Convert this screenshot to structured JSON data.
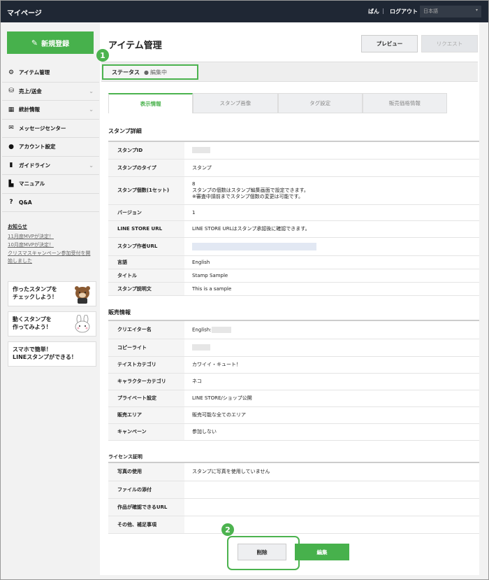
{
  "header": {
    "title": "マイページ",
    "user": "ぱん",
    "separator": "|",
    "logout": "ログアウト",
    "language": "日本語",
    "language_caret": "▾"
  },
  "sidebar": {
    "new_button": "新規登録",
    "items": [
      {
        "label": "アイテム管理",
        "icon": "gear-icon",
        "glyph": "⚙",
        "chev": ""
      },
      {
        "label": "売上/送金",
        "icon": "coins-icon",
        "glyph": "⛁",
        "chev": "⌄"
      },
      {
        "label": "統計情報",
        "icon": "chart-icon",
        "glyph": "▦",
        "chev": "⌄"
      },
      {
        "label": "メッセージセンター",
        "icon": "mail-icon",
        "glyph": "✉",
        "chev": ""
      },
      {
        "label": "アカウント設定",
        "icon": "person-icon",
        "glyph": "●",
        "chev": ""
      },
      {
        "label": "ガイドライン",
        "icon": "book-icon",
        "glyph": "▮",
        "chev": "⌄"
      },
      {
        "label": "マニュアル",
        "icon": "document-icon",
        "glyph": "▙",
        "chev": ""
      },
      {
        "label": "Q&A",
        "icon": "help-icon",
        "glyph": "?",
        "chev": ""
      }
    ],
    "news": {
      "heading": "お知らせ",
      "links": [
        "11月度MVPが決定！",
        "10月度MVPが決定！",
        "クリスマスキャンペーン参加受付を開始しました"
      ]
    },
    "cards": [
      {
        "line1": "作ったスタンプを",
        "line2": "チェックしよう！"
      },
      {
        "line1": "動くスタンプを",
        "line2": "作ってみよう！"
      },
      {
        "line1": "スマホで簡単！",
        "line2": "LINEスタンプができる！"
      }
    ]
  },
  "main": {
    "title": "アイテム管理",
    "preview_button": "プレビュー",
    "request_button": "リクエスト",
    "status_label": "ステータス",
    "status_dot": "●",
    "status_value": "編集中",
    "marker1": "1",
    "marker2": "2",
    "tabs": [
      "表示情報",
      "スタンプ画像",
      "タグ設定",
      "販売価格情報"
    ],
    "stamp_section": "スタンプ詳細",
    "stamp_rows": [
      {
        "k": "スタンプID",
        "v": ""
      },
      {
        "k": "スタンプのタイプ",
        "v": "スタンプ"
      },
      {
        "k": "スタンプ個数(1セット)",
        "v": "8",
        "v2": "スタンプの個数はスタンプ編集画面で設定できます。",
        "v3": "※審査中請前までスタンプ個数の変更は可能です。"
      },
      {
        "k": "バージョン",
        "v": "1"
      },
      {
        "k": "LINE STORE URL",
        "v": "LINE STORE URLはスタンプ承認後に確認できます。"
      },
      {
        "k": "スタンプ作者URL",
        "v": ""
      },
      {
        "k": "言語",
        "v": "English"
      },
      {
        "k": "タイトル",
        "v": "Stamp Sample"
      },
      {
        "k": "スタンプ説明文",
        "v": "This is a sample"
      }
    ],
    "sales_section": "販売情報",
    "sales_rows": [
      {
        "k": "クリエイター名",
        "v": "English:"
      },
      {
        "k": "コピーライト",
        "v": ""
      },
      {
        "k": "テイストカテゴリ",
        "v": "カワイイ・キュート！"
      },
      {
        "k": "キャラクターカテゴリ",
        "v": "ネコ"
      },
      {
        "k": "プライベート設定",
        "v": "LINE STORE/ショップ公開"
      },
      {
        "k": "販売エリア",
        "v": "販売可能な全てのエリア"
      },
      {
        "k": "キャンペーン",
        "v": "参加しない"
      }
    ],
    "license_section": "ライセンス証明",
    "license_rows": [
      {
        "k": "写真の使用",
        "v": "スタンプに写真を使用していません"
      },
      {
        "k": "ファイルの添付",
        "v": ""
      },
      {
        "k": "作品が確認できるURL",
        "v": ""
      },
      {
        "k": "その他、補足事項",
        "v": ""
      }
    ],
    "delete_button": "削除",
    "edit_button": "編集"
  },
  "colors": {
    "accent": "#47b14c",
    "topbar": "#1f2734"
  }
}
